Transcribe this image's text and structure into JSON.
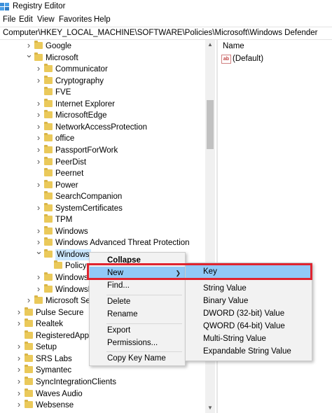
{
  "window": {
    "title": "Registry Editor"
  },
  "menubar": [
    "File",
    "Edit",
    "View",
    "Favorites",
    "Help"
  ],
  "address": "Computer\\HKEY_LOCAL_MACHINE\\SOFTWARE\\Policies\\Microsoft\\Windows Defender",
  "tree": [
    {
      "label": "Google",
      "chevron": ">",
      "level": 0
    },
    {
      "label": "Microsoft",
      "chevron": "v",
      "level": 0
    },
    {
      "label": "Communicator",
      "chevron": ">",
      "level": 1
    },
    {
      "label": "Cryptography",
      "chevron": ">",
      "level": 1
    },
    {
      "label": "FVE",
      "chevron": "",
      "level": 1
    },
    {
      "label": "Internet Explorer",
      "chevron": ">",
      "level": 1
    },
    {
      "label": "MicrosoftEdge",
      "chevron": ">",
      "level": 1
    },
    {
      "label": "NetworkAccessProtection",
      "chevron": ">",
      "level": 1
    },
    {
      "label": "office",
      "chevron": ">",
      "level": 1
    },
    {
      "label": "PassportForWork",
      "chevron": ">",
      "level": 1
    },
    {
      "label": "PeerDist",
      "chevron": ">",
      "level": 1
    },
    {
      "label": "Peernet",
      "chevron": "",
      "level": 1
    },
    {
      "label": "Power",
      "chevron": ">",
      "level": 1
    },
    {
      "label": "SearchCompanion",
      "chevron": "",
      "level": 1
    },
    {
      "label": "SystemCertificates",
      "chevron": ">",
      "level": 1
    },
    {
      "label": "TPM",
      "chevron": "",
      "level": 1
    },
    {
      "label": "Windows",
      "chevron": ">",
      "level": 1
    },
    {
      "label": "Windows Advanced Threat Protection",
      "chevron": ">",
      "level": 1
    },
    {
      "label": "Windows",
      "chevron": "v",
      "level": 1,
      "selected": true
    },
    {
      "label": "Policy",
      "chevron": "",
      "level": 2
    },
    {
      "label": "Windows",
      "chevron": ">",
      "level": 1
    },
    {
      "label": "WindowsF",
      "chevron": ">",
      "level": 1
    },
    {
      "label": "Microsoft Ser",
      "chevron": ">",
      "level": 0
    },
    {
      "label": "Pulse Secure",
      "chevron": ">",
      "level": -1
    },
    {
      "label": "Realtek",
      "chevron": ">",
      "level": -1
    },
    {
      "label": "RegisteredAppli",
      "chevron": "",
      "level": -1
    },
    {
      "label": "Setup",
      "chevron": ">",
      "level": -1
    },
    {
      "label": "SRS Labs",
      "chevron": ">",
      "level": -1
    },
    {
      "label": "Symantec",
      "chevron": ">",
      "level": -1
    },
    {
      "label": "SyncIntegrationClients",
      "chevron": ">",
      "level": -1
    },
    {
      "label": "Waves Audio",
      "chevron": ">",
      "level": -1
    },
    {
      "label": "Websense",
      "chevron": ">",
      "level": -1
    }
  ],
  "right_pane": {
    "column_name": "Name",
    "value_icon": "ab",
    "value_name": "(Default)"
  },
  "context_menu": {
    "items": [
      {
        "label": "Collapse",
        "bold": true
      },
      {
        "label": "New",
        "submenu": true,
        "highlighted": true
      },
      {
        "label": "Find..."
      },
      {
        "label": "Delete"
      },
      {
        "label": "Rename"
      },
      {
        "label": "Export"
      },
      {
        "label": "Permissions..."
      },
      {
        "label": "Copy Key Name"
      }
    ]
  },
  "submenu": {
    "items": [
      {
        "label": "Key",
        "highlighted": true
      },
      {
        "label": "String Value"
      },
      {
        "label": "Binary Value"
      },
      {
        "label": "DWORD (32-bit) Value"
      },
      {
        "label": "QWORD (64-bit) Value"
      },
      {
        "label": "Multi-String Value"
      },
      {
        "label": "Expandable String Value"
      }
    ]
  },
  "colors": {
    "highlight": "#91c9f7",
    "selection": "#cce8ff",
    "annotation": "#e0242f",
    "folder": "#eac95a"
  }
}
